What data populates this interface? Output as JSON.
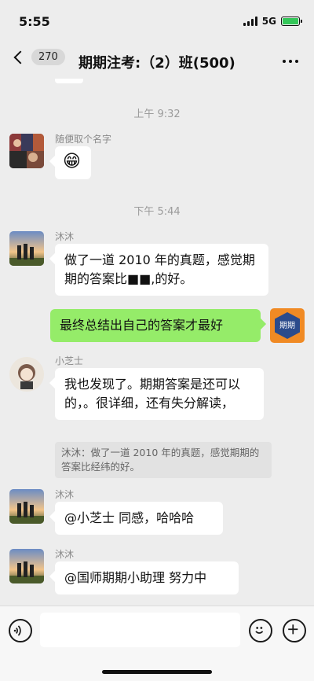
{
  "status_bar": {
    "time": "5:55",
    "network": "5G"
  },
  "nav": {
    "unread_count": "270",
    "title": "期期注考:（2）班(500)"
  },
  "messages": [
    {
      "kind": "time",
      "text": "上午 9:32"
    },
    {
      "kind": "msg",
      "sender": "随便取个名字",
      "text": "😁"
    },
    {
      "kind": "time",
      "text": "下午 5:44"
    },
    {
      "kind": "msg",
      "sender": "沐沐",
      "text": "做了一道 2010 年的真题，感觉期期的答案比■■,的好。"
    },
    {
      "kind": "self",
      "text": "最终总结出自己的答案才最好",
      "avatar_text": "期期"
    },
    {
      "kind": "msg",
      "sender": "小芝士",
      "text": "我也发现了。期期答案是还可以的，。很详细，还有失分解读，",
      "quote": "沐沐：做了一道 2010 年的真题，感觉期期的答案比经纬的好。"
    },
    {
      "kind": "msg",
      "sender": "沐沐",
      "text": "@小芝士 同感，哈哈哈"
    },
    {
      "kind": "msg",
      "sender": "沐沐",
      "text": "@国师期期小助理 努力中"
    }
  ],
  "colors": {
    "background": "#ededed",
    "self_bubble": "#95ec69",
    "accent_brand": "#2b4b8c"
  }
}
